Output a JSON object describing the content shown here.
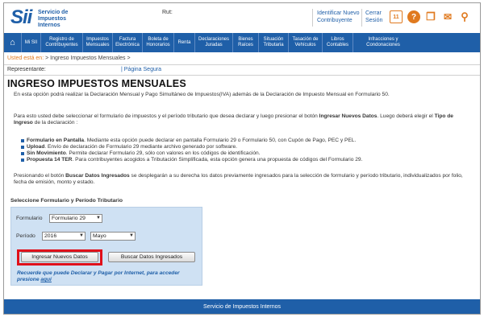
{
  "header": {
    "logo_mark": "Sii",
    "logo_text": [
      "Servicio de",
      "Impuestos",
      "Internos"
    ],
    "rut_label": "Rut:",
    "identificar": [
      "Identificar Nuevo",
      "Contribuyente"
    ],
    "cerrar": [
      "Cerrar",
      "Sesión"
    ],
    "calendar_day": "11",
    "icons": [
      "calendar-icon",
      "help-icon",
      "document-icon",
      "mail-icon",
      "search-icon"
    ]
  },
  "nav": [
    {
      "label": "⌂",
      "icon": "home-icon"
    },
    {
      "label": "Mi SII"
    },
    {
      "label": "Registro de Contribuyentes"
    },
    {
      "label": "Impuestos Mensuales"
    },
    {
      "label": "Factura Electrónica"
    },
    {
      "label": "Boleta de Honorarios"
    },
    {
      "label": "Renta"
    },
    {
      "label": "Declaraciones Juradas"
    },
    {
      "label": "Bienes Raíces"
    },
    {
      "label": "Situación Tributaria"
    },
    {
      "label": "Tasación de Vehículos"
    },
    {
      "label": "Libros Contables"
    },
    {
      "label": "Infracciones y Condonaciones"
    }
  ],
  "breadcrumb": {
    "label": "Usted está en:",
    "path": "> Ingreso Impuestos Mensuales >"
  },
  "representante": "Representante:",
  "pagina_segura": "| Página Segura",
  "title": "INGRESO IMPUESTOS MENSUALES",
  "paragraphs": {
    "p1": "En esta opción podrá realizar la Declaración Mensual y Pago Simultáneo de Impuestos(IVA) además de la Declaración de Impuesto Mensual en Formulario 50.",
    "p2a": "Para esto usted debe seleccionar el formulario de impuestos y el período tributario que desea declarar y luego presionar el botón ",
    "p2b": "Ingresar Nuevos Datos",
    "p2c": ". Luego deberá elegir el ",
    "p2d": "Tipo de Ingreso",
    "p2e": " de la declaración :",
    "p3a": "Presionando el botón ",
    "p3b": "Buscar Datos Ingresados",
    "p3c": " se desplegarán a su derecha los datos previamente ingresados para la selección de formulario y período tributario, individualizados por folio, fecha de emisión, monto y estado."
  },
  "options": [
    {
      "term": "Formulario en Pantalla",
      "desc": ". Mediante esta opción puede declarar en pantalla Formulario 29 o Formulario 50, con Cupón de Pago, PEC y PEL."
    },
    {
      "term": "Upload",
      "desc": ". Envío de declaración de Formulario 29 mediante archivo generado por software."
    },
    {
      "term": "Sin Movimiento",
      "desc": ". Permite declarar Formulario 29, sólo con valores en los códigos de identificación."
    },
    {
      "term": "Propuesta 14 TER",
      "desc": ". Para contribuyentes acogidos a Tributación Simplificada, esta opción genera una propuesta de códigos del Formulario 29."
    }
  ],
  "form": {
    "section_title": "Seleccione Formulario y Período Tributario",
    "formulario_label": "Formulario",
    "formulario_value": "Formulario 29",
    "periodo_label": "Período",
    "anio_value": "2016",
    "mes_value": "Mayo",
    "btn_ingresar": "Ingresar Nuevos Datos",
    "btn_buscar": "Buscar Datos Ingresados",
    "recuerde": "Recuerde que puede Declarar y Pagar por Internet, para acceder presione ",
    "recuerde_link": "aquí"
  },
  "footer": "Servicio de Impuestos Internos",
  "colors": {
    "brand_blue": "#1f5fa8",
    "accent_orange": "#e07a1f",
    "highlight_red": "#e0101a",
    "panel_bg": "#cfe1f3"
  }
}
